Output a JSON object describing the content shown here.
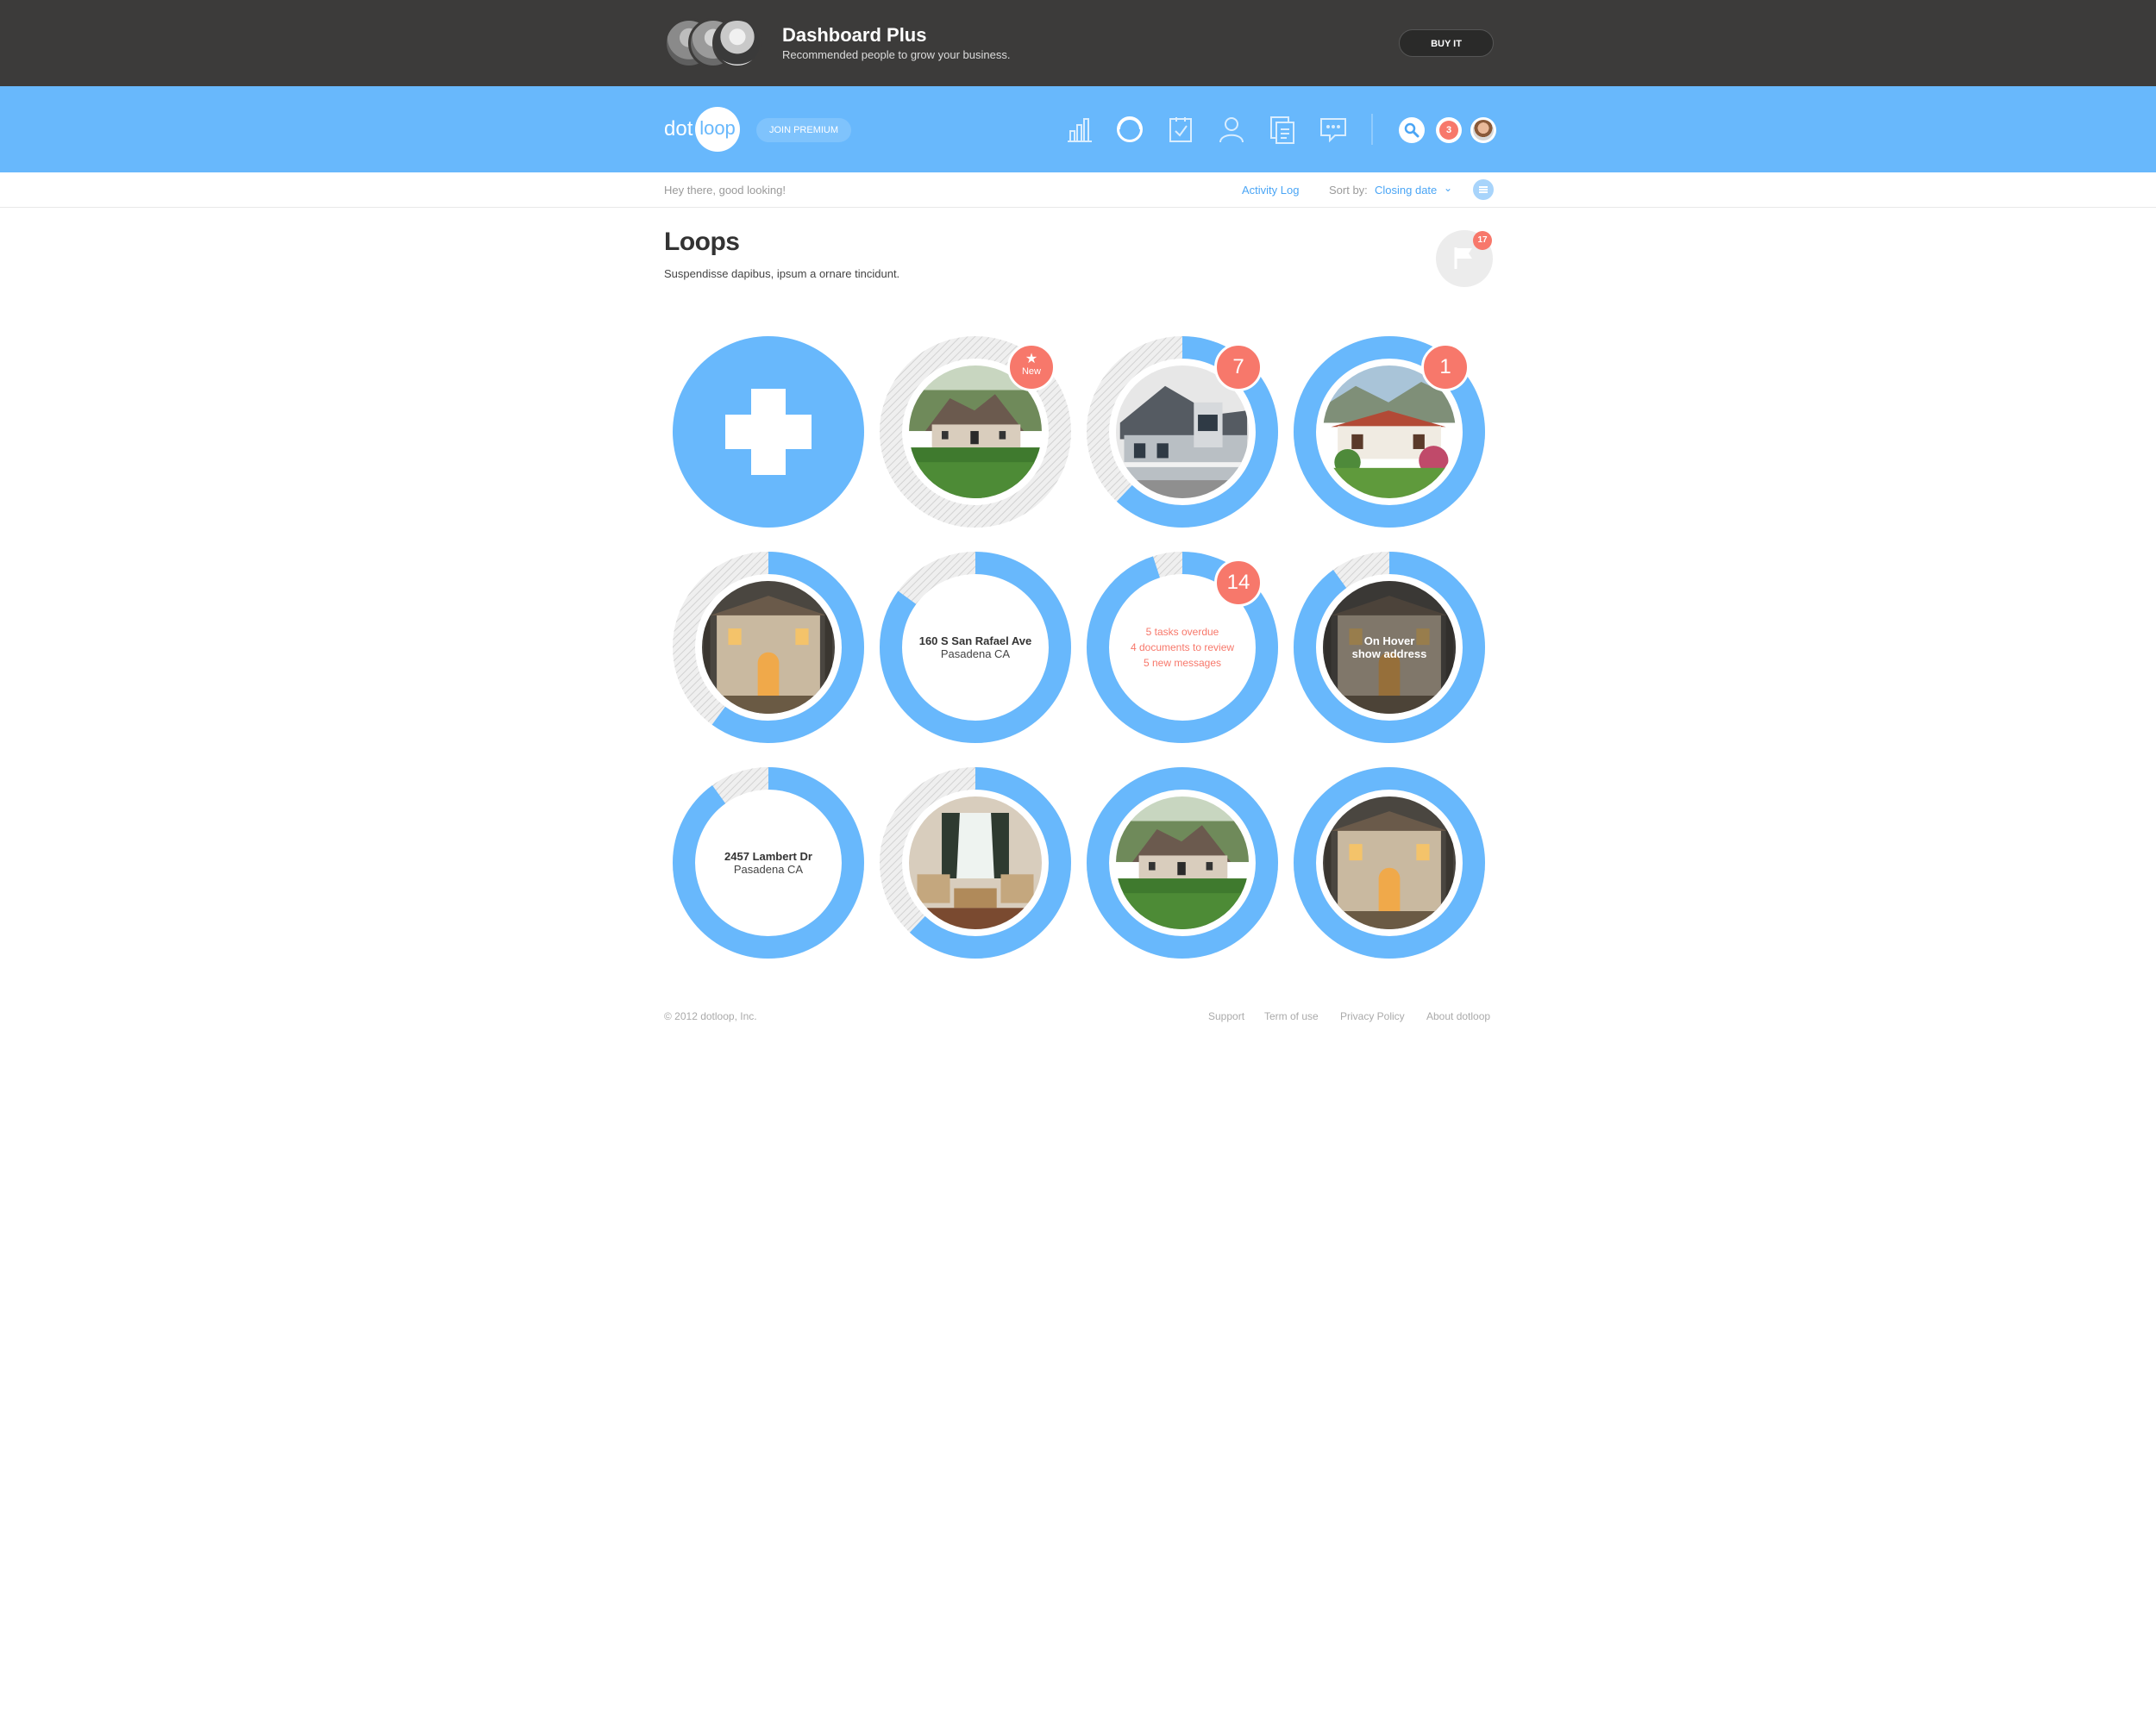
{
  "promo": {
    "title": "Dashboard Plus",
    "subtitle": "Recommended people to grow your business.",
    "buy_label": "BUY IT"
  },
  "nav": {
    "logo_dot": "dot",
    "logo_loop": "loop",
    "premium_label": "JOIN PREMIUM",
    "icons": [
      "chart-icon",
      "loop-icon",
      "task-icon",
      "people-icon",
      "documents-icon",
      "messages-icon"
    ],
    "notification_count": "3"
  },
  "subbar": {
    "greeting": "Hey there, good looking!",
    "activity_log": "Activity Log",
    "sort_label": "Sort by:",
    "sort_value": "Closing date"
  },
  "page": {
    "title": "Loops",
    "subtitle": "Suspendisse dapibus, ipsum a ornare tincidunt.",
    "flag_count": "17"
  },
  "loops": [
    {
      "id": "add",
      "kind": "add"
    },
    {
      "id": "l1",
      "kind": "photo",
      "progress": 0.0,
      "badge": "New",
      "badge_star": "★",
      "scene": "tudor"
    },
    {
      "id": "l2",
      "kind": "photo",
      "progress": 0.62,
      "badge": "7",
      "scene": "colonial"
    },
    {
      "id": "l3",
      "kind": "photo",
      "progress": 1.0,
      "badge": "1",
      "scene": "spanish"
    },
    {
      "id": "l4",
      "kind": "photo",
      "progress": 0.6,
      "scene": "mission"
    },
    {
      "id": "l5",
      "kind": "text",
      "progress": 0.85,
      "address_line1": "160 S San Rafael Ave",
      "address_line2": "Pasadena CA"
    },
    {
      "id": "l6",
      "kind": "alerts",
      "progress": 0.95,
      "badge": "14",
      "alerts": [
        "5 tasks overdue",
        "4 documents to review",
        "5 new messages"
      ]
    },
    {
      "id": "l7",
      "kind": "hover",
      "progress": 0.9,
      "hover_line1": "On Hover",
      "hover_line2": "show address",
      "scene": "mission"
    },
    {
      "id": "l8",
      "kind": "text",
      "progress": 0.9,
      "address_line1": "2457 Lambert Dr",
      "address_line2": "Pasadena CA"
    },
    {
      "id": "l9",
      "kind": "photo",
      "progress": 0.62,
      "scene": "interior"
    },
    {
      "id": "l10",
      "kind": "photo",
      "progress": 1.0,
      "scene": "tudor"
    },
    {
      "id": "l11",
      "kind": "photo",
      "progress": 1.0,
      "scene": "mission"
    }
  ],
  "footer": {
    "copyright": "© 2012 dotloop, Inc.",
    "links": [
      "Support",
      "Term of use",
      "Privacy Policy",
      "About dotloop"
    ]
  },
  "colors": {
    "accent": "#68b8fc",
    "alert": "#f7786b",
    "dark": "#3c3b3a"
  }
}
